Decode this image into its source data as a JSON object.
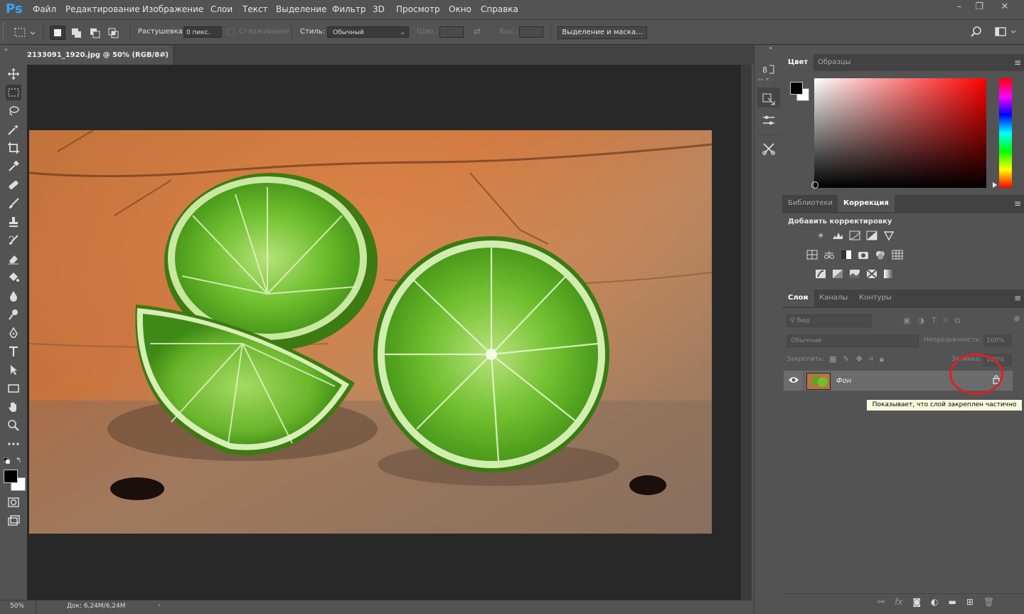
{
  "app": {
    "logo": "Ps"
  },
  "menu": [
    "Файл",
    "Редактирование",
    "Изображение",
    "Слои",
    "Текст",
    "Выделение",
    "Фильтр",
    "3D",
    "Просмотр",
    "Окно",
    "Справка"
  ],
  "window_controls": {
    "minimize": "–",
    "restore": "❐",
    "close": "✕"
  },
  "options": {
    "feather_label": "Растушевка:",
    "feather_value": "0 пикс.",
    "antialias_label": "Сглаживание",
    "style_label": "Стиль:",
    "style_value": "Обычный",
    "width_label": "Шир.:",
    "height_label": "Выс.:",
    "select_mask_button": "Выделение и маска..."
  },
  "document": {
    "tab_title": "2133091_1920.jpg @ 50% (RGB/8#)",
    "zoom": "50%",
    "doc_size": "Док: 6,24M/6,24M"
  },
  "color_panel": {
    "tabs": [
      "Цвет",
      "Образцы"
    ],
    "active": 0
  },
  "adjust_panel": {
    "tabs": [
      "Библиотеки",
      "Коррекция"
    ],
    "active": 1,
    "heading": "Добавить корректировку"
  },
  "layers_panel": {
    "tabs": [
      "Слои",
      "Каналы",
      "Контуры"
    ],
    "active": 0,
    "filter_placeholder": "Вид",
    "blend_mode": "Обычные",
    "opacity_label": "Непрозрачность:",
    "opacity_value": "100%",
    "lock_label": "Закрепить:",
    "fill_label": "Заливка:",
    "fill_value": "100%",
    "layer_name": "Фон",
    "tooltip": "Показывает, что слой закреплен частично"
  },
  "colors": {
    "accent_ps": "#31a8ff",
    "highlight": "#e02020"
  }
}
